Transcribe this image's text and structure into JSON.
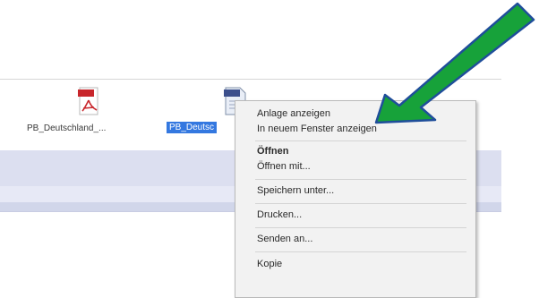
{
  "attachments": [
    {
      "name": "PB_Deutschland_...",
      "type": "pdf",
      "selected": false
    },
    {
      "name": "PB_Deutsc",
      "type": "document",
      "selected": true
    }
  ],
  "context_menu": {
    "items": [
      {
        "label": "Anlage anzeigen",
        "bold": false
      },
      {
        "label": "In neuem Fenster anzeigen",
        "bold": false
      },
      {
        "label": "Öffnen",
        "bold": true
      },
      {
        "label": "Öffnen mit...",
        "bold": false
      },
      {
        "label": "Speichern unter...",
        "bold": false
      },
      {
        "label": "Drucken...",
        "bold": false
      },
      {
        "label": "Senden an...",
        "bold": false
      },
      {
        "label": "Kopie",
        "bold": false
      }
    ]
  },
  "colors": {
    "selection": "#3478e0",
    "arrow_fill": "#17a23a",
    "arrow_stroke": "#1f4e9a",
    "pdf_red": "#c8262b"
  },
  "annotation": {
    "icon": "green-arrow-pointing-to-menu-item"
  }
}
